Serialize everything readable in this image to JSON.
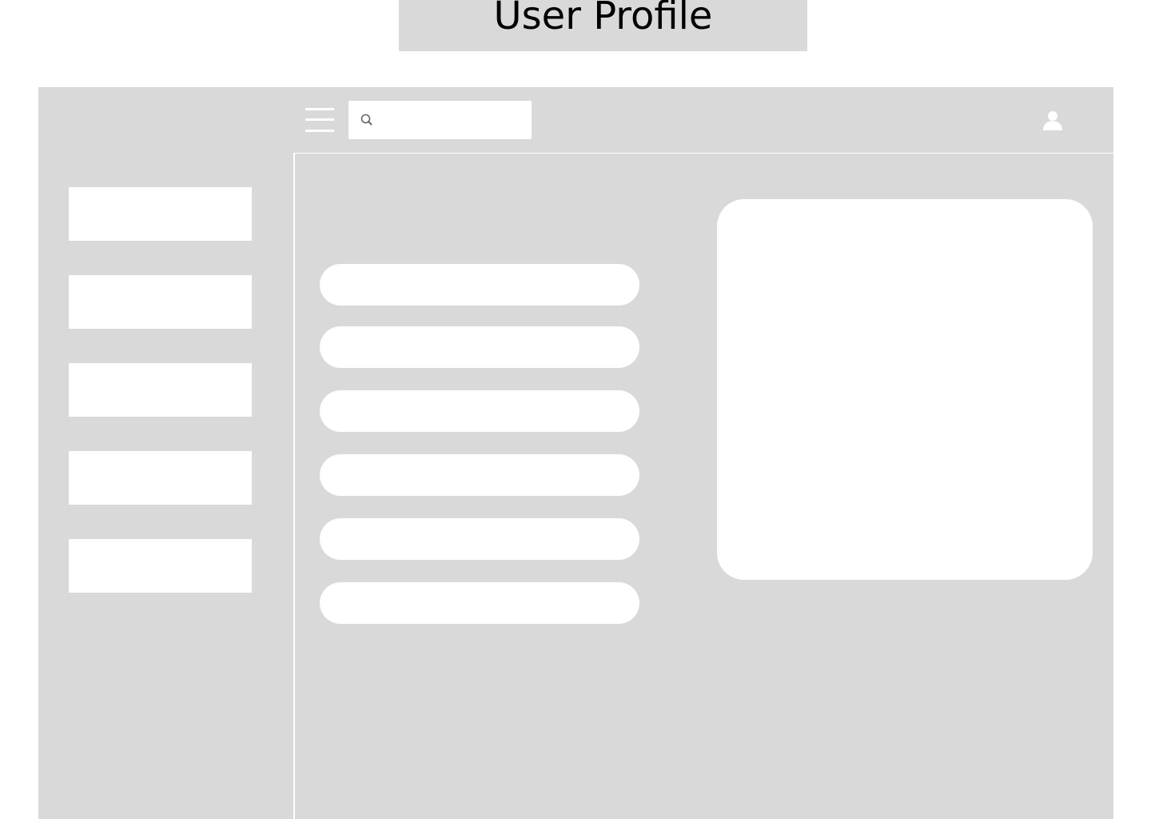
{
  "page": {
    "title": "User Profile"
  },
  "colors": {
    "background": "#ffffff",
    "frame": "#d9d9d9",
    "placeholder_block": "#ffffff",
    "title_text": "#000000",
    "icon_gray": "#666666"
  },
  "header": {
    "menu_icon": "hamburger-menu-icon",
    "search": {
      "icon": "search-icon",
      "value": "",
      "placeholder": ""
    },
    "user_icon": "user-icon"
  },
  "sidebar": {
    "items": [
      {
        "label": ""
      },
      {
        "label": ""
      },
      {
        "label": ""
      },
      {
        "label": ""
      },
      {
        "label": ""
      }
    ]
  },
  "main": {
    "fields": [
      {
        "value": ""
      },
      {
        "value": ""
      },
      {
        "value": ""
      },
      {
        "value": ""
      },
      {
        "value": ""
      },
      {
        "value": ""
      }
    ],
    "profile_card": {
      "content": ""
    }
  }
}
